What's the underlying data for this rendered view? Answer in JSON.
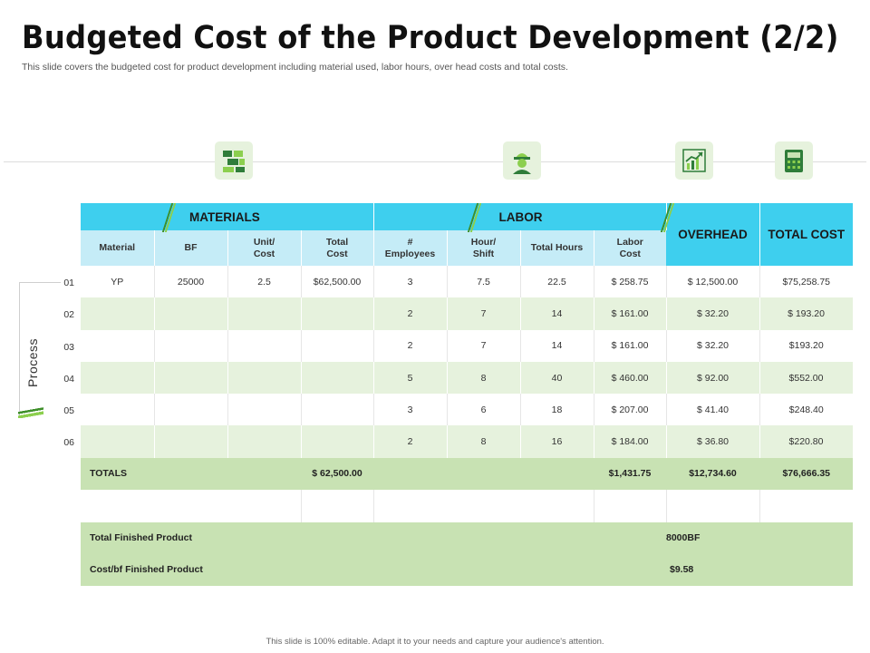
{
  "title": "Budgeted Cost of the Product Development (2/2)",
  "subtitle": "This slide covers the budgeted cost for product development including material used, labor hours, over head costs and total costs.",
  "icons": [
    "building-blocks-icon",
    "engineer-worker-icon",
    "growth-chart-icon",
    "calculator-icon"
  ],
  "groups": {
    "materials": "MATERIALS",
    "labor": "LABOR",
    "overhead": "OVERHEAD",
    "total_cost": "TOTAL COST"
  },
  "columns": {
    "material": "Material",
    "bf": "BF",
    "unit_cost_1": "Unit/",
    "unit_cost_2": "Cost",
    "total_cost_1": "Total",
    "total_cost_2": "Cost",
    "employees_1": "#",
    "employees_2": "Employees",
    "hour_shift_1": "Hour/",
    "hour_shift_2": "Shift",
    "total_hours": "Total Hours",
    "labor_cost_1": "Labor",
    "labor_cost_2": "Cost"
  },
  "process": {
    "label": "Process",
    "numbers": [
      "01",
      "02",
      "03",
      "04",
      "05",
      "06"
    ]
  },
  "rows": [
    {
      "material": "YP",
      "bf": "25000",
      "unit_cost": "2.5",
      "total_cost": "$62,500.00",
      "employees": "3",
      "hour_shift": "7.5",
      "total_hours": "22.5",
      "labor_cost": "$ 258.75",
      "overhead": "$ 12,500.00",
      "total": "$75,258.75"
    },
    {
      "material": "",
      "bf": "",
      "unit_cost": "",
      "total_cost": "",
      "employees": "2",
      "hour_shift": "7",
      "total_hours": "14",
      "labor_cost": "$ 161.00",
      "overhead": "$ 32.20",
      "total": "$ 193.20"
    },
    {
      "material": "",
      "bf": "",
      "unit_cost": "",
      "total_cost": "",
      "employees": "2",
      "hour_shift": "7",
      "total_hours": "14",
      "labor_cost": "$ 161.00",
      "overhead": "$ 32.20",
      "total": "$193.20"
    },
    {
      "material": "",
      "bf": "",
      "unit_cost": "",
      "total_cost": "",
      "employees": "5",
      "hour_shift": "8",
      "total_hours": "40",
      "labor_cost": "$ 460.00",
      "overhead": "$ 92.00",
      "total": "$552.00"
    },
    {
      "material": "",
      "bf": "",
      "unit_cost": "",
      "total_cost": "",
      "employees": "3",
      "hour_shift": "6",
      "total_hours": "18",
      "labor_cost": "$ 207.00",
      "overhead": "$ 41.40",
      "total": "$248.40"
    },
    {
      "material": "",
      "bf": "",
      "unit_cost": "",
      "total_cost": "",
      "employees": "2",
      "hour_shift": "8",
      "total_hours": "16",
      "labor_cost": "$ 184.00",
      "overhead": "$ 36.80",
      "total": "$220.80"
    }
  ],
  "totals": {
    "label": "TOTALS",
    "material_total": "$ 62,500.00",
    "labor_total": "$1,431.75",
    "overhead_total": "$12,734.60",
    "grand_total": "$76,666.35"
  },
  "finished": {
    "product_label": "Total Finished Product",
    "product_value": "8000BF",
    "cost_label": "Cost/bf  Finished Product",
    "cost_value": "$9.58"
  },
  "footer": "This slide is 100% editable. Adapt it to your needs and capture your audience's attention.",
  "colors": {
    "header_blue": "#3ecfee",
    "subheader_blue": "#c5ecf7",
    "row_green": "#e6f2dd",
    "totals_green": "#c8e2b3",
    "icon_green": "#3e8f2a"
  }
}
